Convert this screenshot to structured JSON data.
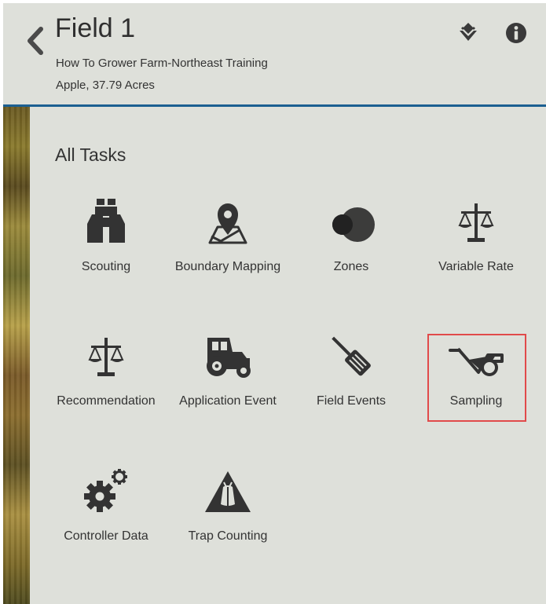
{
  "header": {
    "title": "Field 1",
    "farm": "How To Grower Farm-Northeast Training",
    "crop_area": "Apple, 37.79 Acres",
    "accent_color": "#1b5f91"
  },
  "section": {
    "title": "All Tasks"
  },
  "tasks": [
    {
      "label": "Scouting",
      "icon": "binoculars-icon"
    },
    {
      "label": "Boundary Mapping",
      "icon": "map-pin-icon"
    },
    {
      "label": "Zones",
      "icon": "zones-icon"
    },
    {
      "label": "Variable Rate",
      "icon": "scale-icon"
    },
    {
      "label": "Recommendation",
      "icon": "scale-icon"
    },
    {
      "label": "Application Event",
      "icon": "tractor-icon"
    },
    {
      "label": "Field Events",
      "icon": "spatula-icon"
    },
    {
      "label": "Sampling",
      "icon": "wheelbarrow-icon",
      "highlighted": true,
      "highlight_color": "#e14a4a"
    },
    {
      "label": "Controller Data",
      "icon": "gears-icon"
    },
    {
      "label": "Trap Counting",
      "icon": "trap-icon"
    }
  ]
}
